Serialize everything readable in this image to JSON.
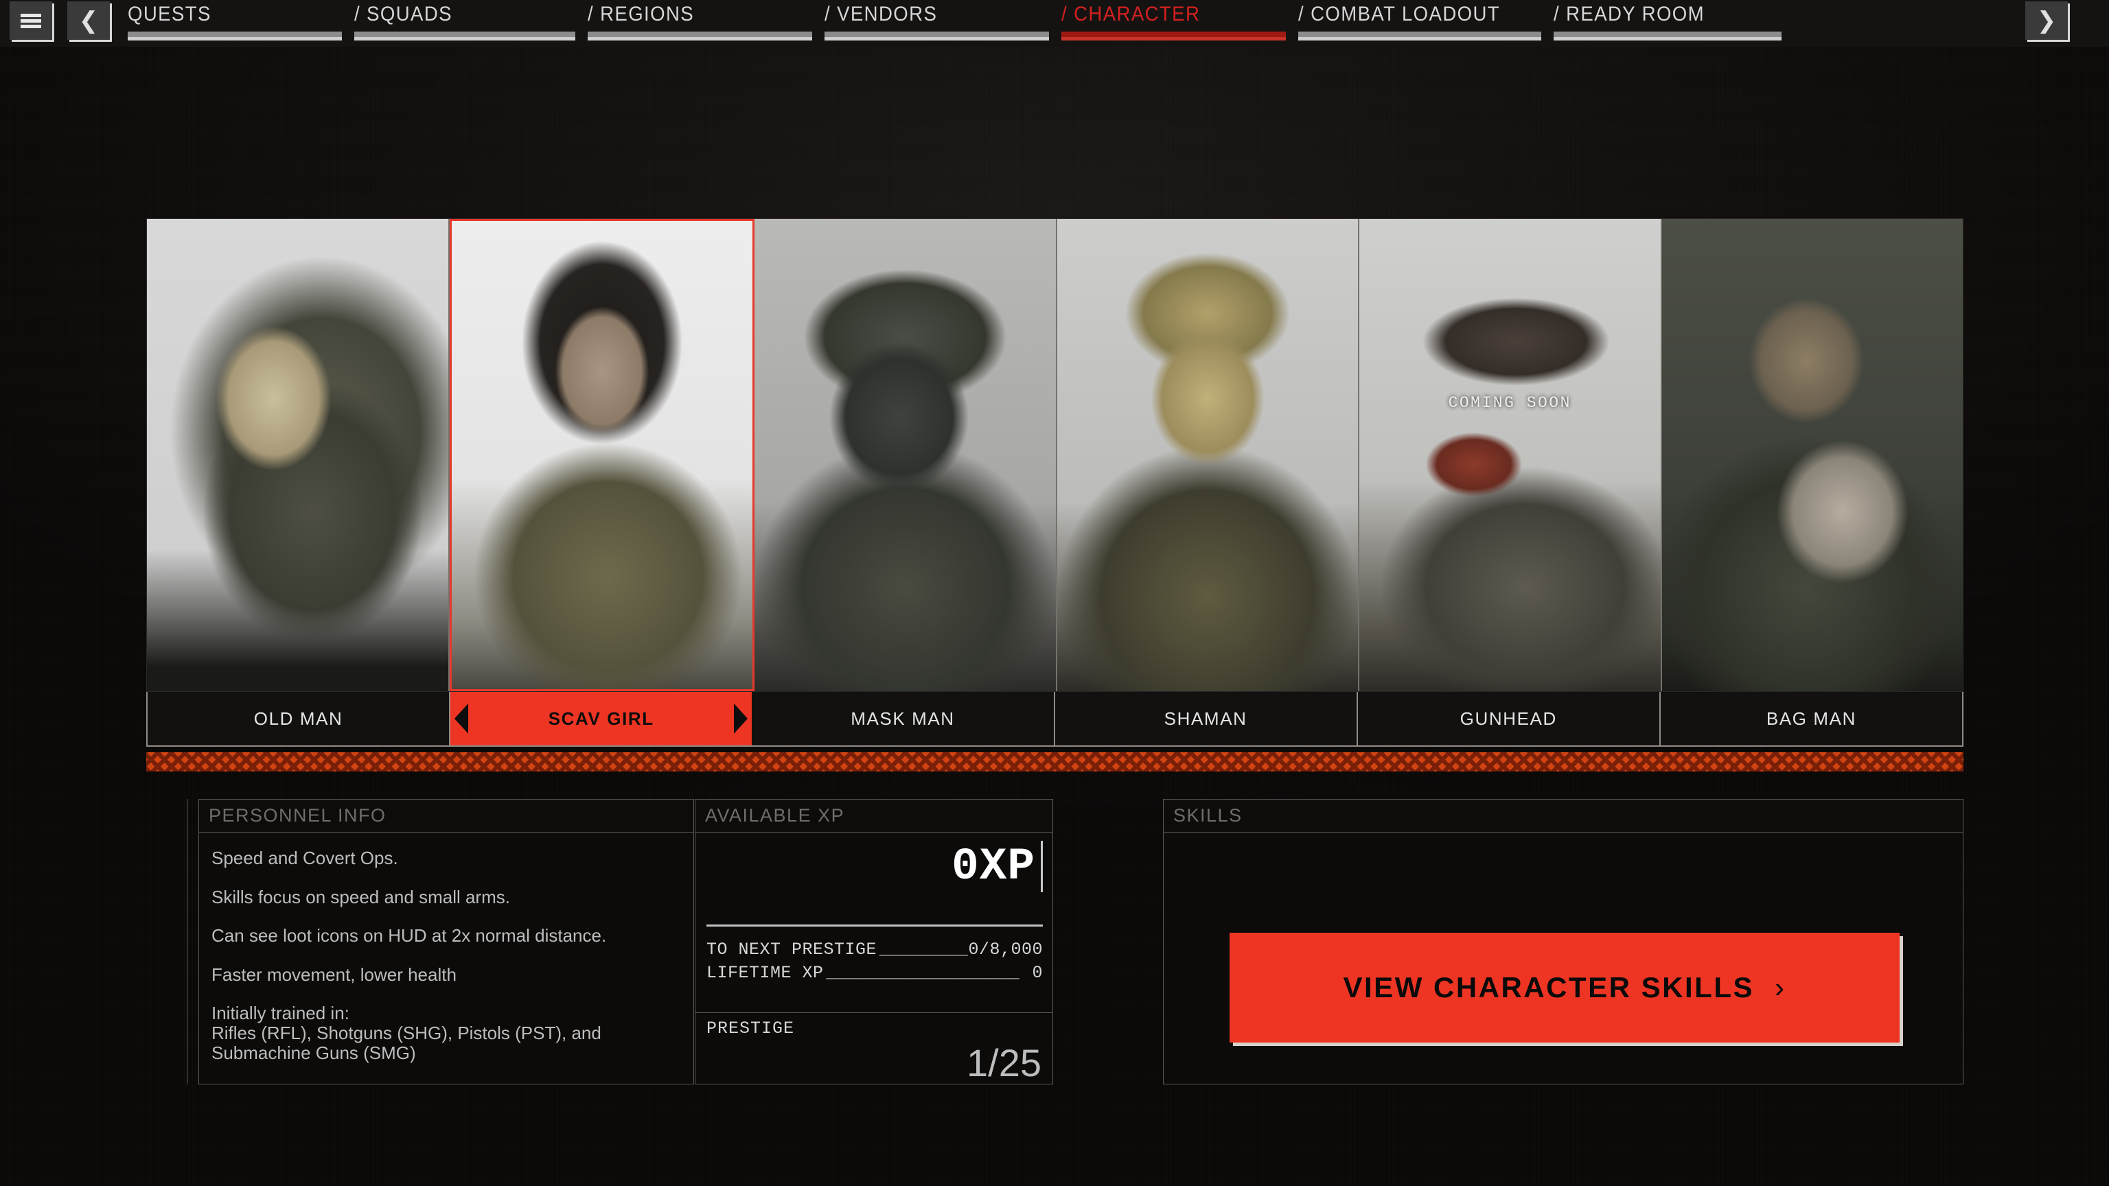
{
  "nav": {
    "menu_icon": "hamburger-icon",
    "prev_icon": "chevron-left-icon",
    "next_icon": "chevron-right-icon",
    "accent_red": "#d42020",
    "tabs": [
      {
        "label": "QUESTS",
        "active": false
      },
      {
        "label": "/ SQUADS",
        "active": false
      },
      {
        "label": "/ REGIONS",
        "active": false
      },
      {
        "label": "/ VENDORS",
        "active": false
      },
      {
        "label": "/ CHARACTER",
        "active": true
      },
      {
        "label": "/ COMBAT LOADOUT",
        "active": false
      },
      {
        "label": "/ READY ROOM",
        "active": false
      }
    ]
  },
  "characters": [
    {
      "name": "OLD MAN",
      "selected": false,
      "coming_soon": ""
    },
    {
      "name": "SCAV GIRL",
      "selected": true,
      "coming_soon": ""
    },
    {
      "name": "MASK MAN",
      "selected": false,
      "coming_soon": ""
    },
    {
      "name": "SHAMAN",
      "selected": false,
      "coming_soon": ""
    },
    {
      "name": "GUNHEAD",
      "selected": false,
      "coming_soon": "COMING SOON"
    },
    {
      "name": "BAG MAN",
      "selected": false,
      "coming_soon": ""
    }
  ],
  "personnel": {
    "header": "PERSONNEL INFO",
    "lines": [
      "Speed and Covert Ops.",
      "Skills focus on speed and small arms.",
      "Can see loot icons on HUD at 2x normal distance.",
      "Faster movement, lower health"
    ],
    "training_label": "Initially trained in:",
    "training_value": "Rifles (RFL), Shotguns (SHG), Pistols (PST), and\nSubmachine Guns (SMG)"
  },
  "xp": {
    "header": "AVAILABLE XP",
    "available": "0XP",
    "next_prestige_label": "TO NEXT PRESTIGE",
    "next_prestige_dashes": "__________",
    "next_prestige_value": "0/8,000",
    "lifetime_label": "LIFETIME XP",
    "lifetime_dashes": "____________________",
    "lifetime_value": "0",
    "prestige_label": "PRESTIGE",
    "prestige_value": "1/25"
  },
  "skills": {
    "header": "SKILLS",
    "button_label": "VIEW CHARACTER SKILLS",
    "button_chevron": "›",
    "button_color": "#ee3524"
  }
}
